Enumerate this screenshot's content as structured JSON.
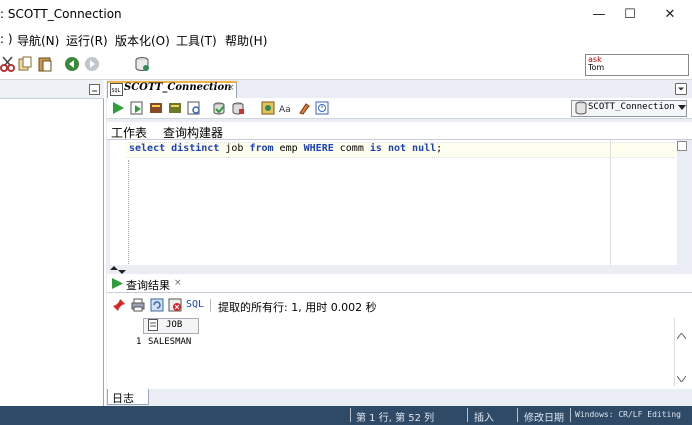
{
  "window": {
    "title": ": SCOTT_Connection",
    "minimize": "—",
    "maximize": "☐",
    "close": "✕"
  },
  "menu": {
    "items": [
      ": )",
      "导航(N)",
      "运行(R)",
      "版本化(O)",
      "工具(T)",
      "帮助(H)"
    ]
  },
  "mini_panel": {
    "line1": "ask",
    "line2": "Tom"
  },
  "editor": {
    "tab_label": "SCOTT_Connection",
    "tab_close": "×",
    "connection_select": "SCOTT_Connection",
    "sub_tabs": [
      "工作表",
      "查询构建器"
    ],
    "sql_text": "select distinct job from emp WHERE comm is not null;",
    "sql_tokens": [
      {
        "t": "select",
        "kw": true
      },
      {
        "t": " ",
        "kw": false
      },
      {
        "t": "distinct",
        "kw": true
      },
      {
        "t": " job ",
        "kw": false
      },
      {
        "t": "from",
        "kw": true
      },
      {
        "t": " emp ",
        "kw": false
      },
      {
        "t": "WHERE",
        "kw": true
      },
      {
        "t": " comm ",
        "kw": false
      },
      {
        "t": "is",
        "kw": true
      },
      {
        "t": " ",
        "kw": false
      },
      {
        "t": "not",
        "kw": true
      },
      {
        "t": " ",
        "kw": false
      },
      {
        "t": "null",
        "kw": true
      },
      {
        "t": ";",
        "kw": false
      }
    ]
  },
  "results": {
    "tab_label": "查询结果",
    "tab_close": "×",
    "sql_button": "SQL",
    "summary": "提取的所有行: 1, 用时 0.002 秒",
    "column_header": "JOB",
    "rows": [
      {
        "num": "1",
        "job": "SALESMAN"
      }
    ]
  },
  "log_tab": "日志",
  "status": {
    "position": "第 1 行, 第 52 列",
    "mode": "插入",
    "modified": "修改日期",
    "encoding": "Windows: CR/LF Editing"
  },
  "colors": {
    "keyword": "#1b3fbf",
    "status_bar": "#2f4a66",
    "tab_accent": "#f0b343"
  }
}
